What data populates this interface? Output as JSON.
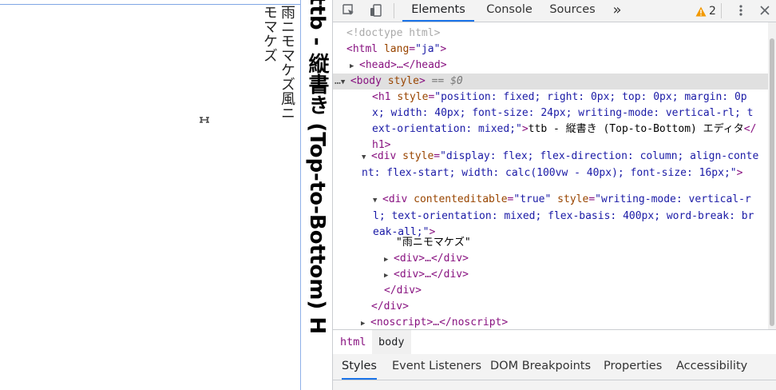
{
  "page": {
    "editable_text": "雨ニモマケズ風ニモマケズ",
    "heading": "ttb - 縦書き (Top-to-Bottom) H"
  },
  "devtools": {
    "tabs": [
      {
        "label": "Elements",
        "active": true
      },
      {
        "label": "Console"
      },
      {
        "label": "Sources"
      },
      {
        "label": "»"
      }
    ],
    "warning_count": "2",
    "dom": {
      "doctype": "<!doctype html>",
      "html_open_tag": "<html",
      "html_lang_attr": "lang",
      "html_lang_val": "\"ja\"",
      "head_collapsed": "<head>…</head>",
      "body_tag": "<body",
      "body_attr": "style",
      "body_eq": "== $0",
      "h1_tag": "<h1",
      "h1_attr": "style",
      "h1_style": "\"position: fixed; right: 0px; top: 0px; margin: 0px; width: 40px; font-size: 24px; writing-mode: vertical-rl; text-orientation: mixed;\"",
      "h1_text": "ttb - 縦書き (Top-to-Bottom) エディタ",
      "h1_close": "</h1>",
      "div_tag": "<div",
      "div_attr": "style",
      "div_style": "\"display: flex; flex-direction: column; align-content: flex-start; width: calc(100vw - 40px); font-size: 16px;\"",
      "inner_div_tag": "<div",
      "inner_ce_attr": "contenteditable",
      "inner_ce_val": "\"true\"",
      "inner_style_attr": "style",
      "inner_style": "\"writing-mode: vertical-rl; text-orientation: mixed; flex-basis: 400px; word-break: break-all;\"",
      "text_node": "\"雨ニモマケズ\"",
      "child_div_1": "<div>…</div>",
      "child_div_2": "<div>…</div>",
      "inner_div_close": "</div>",
      "div_close": "</div>",
      "noscript": "<noscript>…</noscript>"
    },
    "breadcrumbs": [
      "html",
      "body"
    ],
    "subtabs": [
      {
        "label": "Styles",
        "active": true
      },
      {
        "label": "Event Listeners"
      },
      {
        "label": "DOM Breakpoints"
      },
      {
        "label": "Properties"
      },
      {
        "label": "Accessibility"
      }
    ]
  }
}
